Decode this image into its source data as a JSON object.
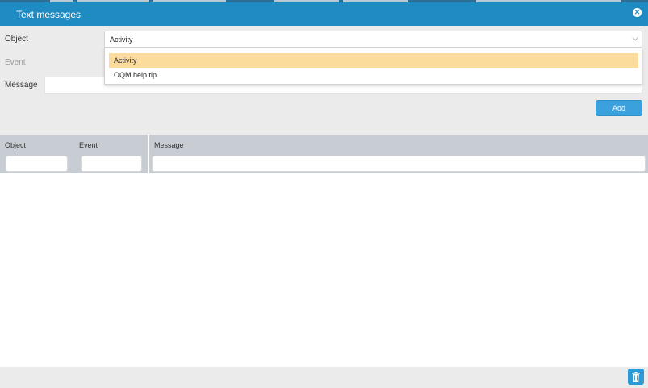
{
  "dialog": {
    "title": "Text messages"
  },
  "form": {
    "object_label": "Object",
    "object_value": "Activity",
    "event_label": "Event",
    "message_label": "Message",
    "message_value": "",
    "add_label": "Add"
  },
  "dropdown": {
    "options": [
      "Activity",
      "OQM help tip"
    ],
    "selected": "Activity"
  },
  "table": {
    "columns": [
      "Object",
      "Event",
      "Message"
    ],
    "rows": []
  },
  "icons": {
    "close": "close-circle-icon",
    "chevron": "chevron-down-icon",
    "delete": "trash-icon"
  },
  "colors": {
    "header": "#1e8bc3",
    "button": "#3aa1dd",
    "highlight": "#fcdc9d"
  }
}
